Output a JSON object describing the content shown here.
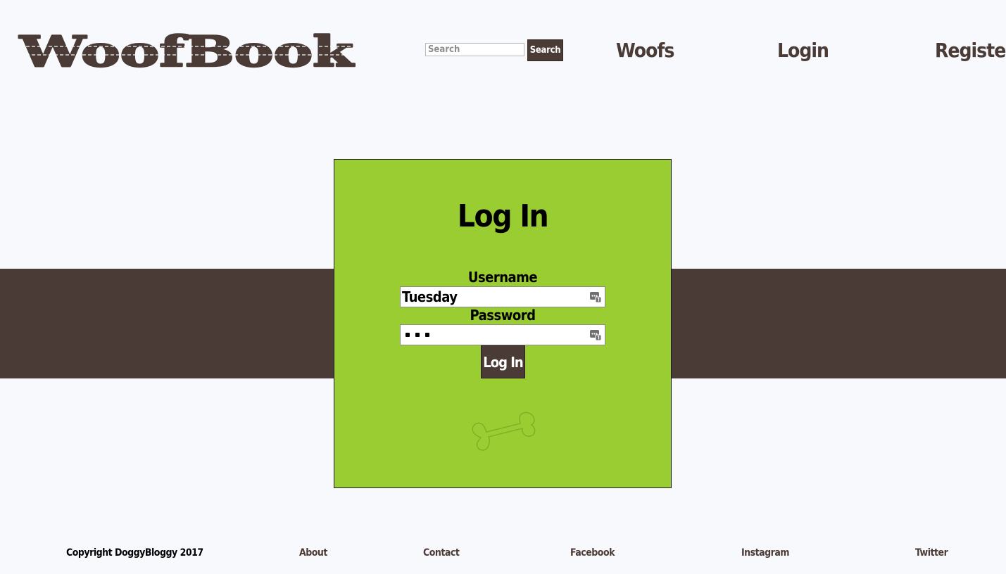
{
  "logo": {
    "text": "WoofBook",
    "color": "#4b3b36"
  },
  "search": {
    "placeholder": "Search",
    "button_label": "Search"
  },
  "nav": {
    "woofs": "Woofs",
    "login": "Login",
    "register": "Register"
  },
  "login_form": {
    "title": "Log In",
    "username_label": "Username",
    "username_value": "Tuesday",
    "password_label": "Password",
    "password_masked_length": 3,
    "submit_label": "Log In",
    "field_icon": "autofill-key-icon",
    "decoration_icon": "bone-icon"
  },
  "footer": {
    "copyright": "Copyright DoggyBloggy 2017",
    "links": {
      "about": "About",
      "contact": "Contact",
      "facebook": "Facebook",
      "instagram": "Instagram",
      "twitter": "Twitter"
    }
  },
  "colors": {
    "page_background": "#f7f9fd",
    "brand_brown": "#4b3b36",
    "panel_green": "#9acd32",
    "bone_stroke": "#7eaf23"
  }
}
